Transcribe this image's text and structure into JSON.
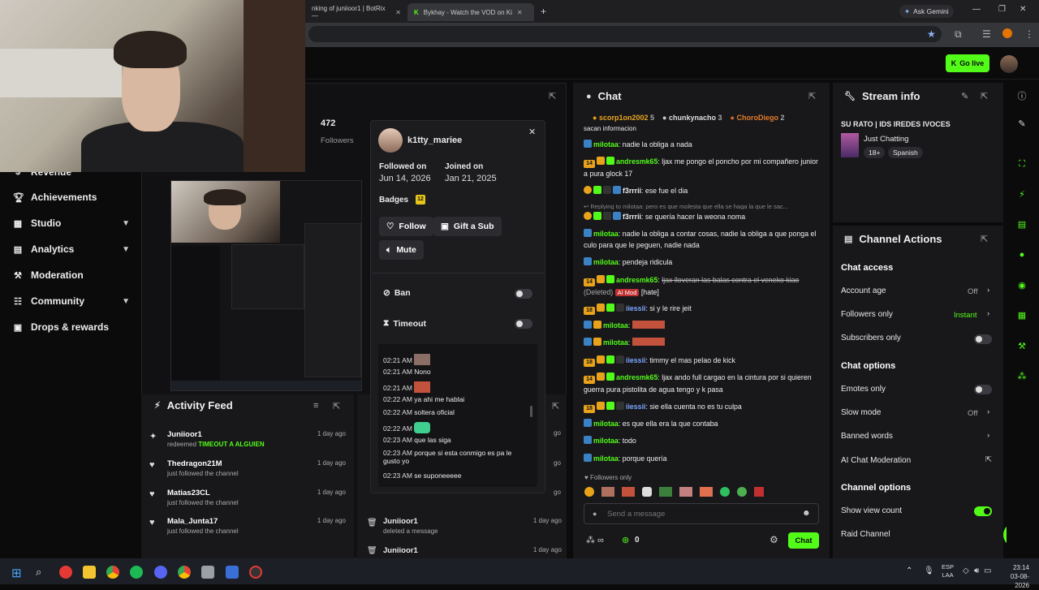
{
  "browser": {
    "tabs": [
      {
        "title": "nking of juniioor1 | BotRix—"
      },
      {
        "title": "Bykhay - Watch the VOD on Ki"
      }
    ],
    "ask_gemini": "Ask Gemini"
  },
  "header": {
    "go_live": "Go live"
  },
  "sidebar": {
    "items": [
      {
        "label": "Revenue",
        "icon": "revenue-icon"
      },
      {
        "label": "Achievements",
        "icon": "trophy-icon"
      },
      {
        "label": "Studio",
        "icon": "studio-icon",
        "chevron": true
      },
      {
        "label": "Analytics",
        "icon": "analytics-icon",
        "chevron": true
      },
      {
        "label": "Moderation",
        "icon": "hammer-icon"
      },
      {
        "label": "Community",
        "icon": "community-icon",
        "chevron": true
      },
      {
        "label": "Drops & rewards",
        "icon": "gift-icon"
      }
    ]
  },
  "stats": {
    "followers_count": "472",
    "followers_label": "Followers"
  },
  "activity_feed": {
    "title": "Activity Feed",
    "items": [
      {
        "name": "Juniioor1",
        "action": "redeemed",
        "reward": "TIMEOUT A ALGUIEN",
        "time": "1 day ago"
      },
      {
        "name": "Thedragon21M",
        "action": "just followed the channel",
        "time": "1 day ago"
      },
      {
        "name": "Matias23CL",
        "action": "just followed the channel",
        "time": "1 day ago"
      },
      {
        "name": "Mala_Junta17",
        "action": "just followed the channel",
        "time": "1 day ago"
      }
    ]
  },
  "mod_log": {
    "items": [
      {
        "name": "Juniioor1",
        "action": "deleted a message",
        "time": "1 day ago"
      },
      {
        "name": "Juniioor1",
        "time": "1 day ago"
      }
    ],
    "side_times": [
      "go",
      "go",
      "go"
    ]
  },
  "user_card": {
    "username": "k1tty_mariee",
    "followed_label": "Followed on",
    "followed_date": "Jun 14, 2026",
    "joined_label": "Joined on",
    "joined_date": "Jan 21, 2025",
    "badges_label": "Badges",
    "badges_count": "12",
    "follow": "Follow",
    "gift_sub": "Gift a Sub",
    "mute": "Mute",
    "ban": "Ban",
    "timeout": "Timeout",
    "messages": [
      {
        "time": "02:21 AM",
        "text": ""
      },
      {
        "time": "02:21 AM",
        "text": "Nono"
      },
      {
        "time": "02:21 AM",
        "text": ""
      },
      {
        "time": "02:22 AM",
        "text": "ya ahi me hablai"
      },
      {
        "time": "02:22 AM",
        "text": "soltera oficial"
      },
      {
        "time": "02:22 AM",
        "text": ""
      },
      {
        "time": "02:23 AM",
        "text": "que las siga"
      },
      {
        "time": "02:23 AM",
        "text": "porque si esta conmigo es pa le gusto yo"
      },
      {
        "time": "02:23 AM",
        "text": "se suponeeeee"
      }
    ]
  },
  "chat": {
    "title": "Chat",
    "top_gifters": [
      {
        "name": "scorp1on2002",
        "count": "5"
      },
      {
        "name": "chunkynacho",
        "count": "3"
      },
      {
        "name": "ChoroDiego",
        "count": "2"
      }
    ],
    "partial_top": "sacan informacion",
    "messages": [
      {
        "user": "milotaa",
        "color": "#53fc18",
        "text": "nadie la obliga a nada"
      },
      {
        "user": "andresmk65",
        "color": "#53fc18",
        "text": "ljax me pongo el poncho por mi compañero junior a pura glock 17",
        "badge_num": "14"
      },
      {
        "user": "f3rrrii",
        "color": "#ffffff",
        "text": "ese fue el dia"
      },
      {
        "reply": "Replying to milotaa: pero es que molesta que ella se haga la que le sac..."
      },
      {
        "user": "f3rrrii",
        "color": "#ffffff",
        "text": "se quería hacer la weona noma"
      },
      {
        "user": "milotaa",
        "color": "#53fc18",
        "text": "nadie la obliga a contar cosas, nadie la obliga a que ponga el culo para que le peguen, nadie nada"
      },
      {
        "user": "milotaa",
        "color": "#53fc18",
        "text": "pendeja ridicula"
      },
      {
        "user": "andresmk65",
        "color": "#53fc18",
        "text": "ljax lloveran las balas contra el veneko kiao",
        "deleted": "(Deleted)",
        "aimod": "AI Mod",
        "hate": "[hate]",
        "badge_num": "14"
      },
      {
        "user": "iiessii",
        "color": "#7aa7ff",
        "text": "si y le rire jeit",
        "badge_num": "18"
      },
      {
        "user": "milotaa",
        "color": "#53fc18",
        "text": ""
      },
      {
        "user": "milotaa",
        "color": "#53fc18",
        "text": ""
      },
      {
        "user": "iiessii",
        "color": "#7aa7ff",
        "text": "timmy el mas pelao de kick",
        "badge_num": "18"
      },
      {
        "user": "andresmk65",
        "color": "#53fc18",
        "text": "ljax ando full cargao en la cintura por si quieren guerra pura pistolita de agua tengo y k pasa",
        "badge_num": "14"
      },
      {
        "user": "iiessii",
        "color": "#7aa7ff",
        "text": "sie ella cuenta no es tu culpa",
        "badge_num": "18"
      },
      {
        "user": "milotaa",
        "color": "#53fc18",
        "text": "es que ella era la que contaba"
      },
      {
        "user": "milotaa",
        "color": "#53fc18",
        "text": "todo"
      },
      {
        "user": "milotaa",
        "color": "#53fc18",
        "text": "porque quería"
      }
    ],
    "followers_only": "Followers only",
    "placeholder": "Send a message",
    "count": "0",
    "send": "Chat"
  },
  "stream_info": {
    "title": "Stream info",
    "stream_title": "SU RATO | IDS IREDES IVOCES",
    "category": "Just Chatting",
    "tags": [
      "18+",
      "Spanish"
    ]
  },
  "channel_actions": {
    "title": "Channel Actions",
    "chat_access": "Chat access",
    "account_age": "Account age",
    "account_age_val": "Off",
    "followers_only": "Followers only",
    "followers_only_val": "Instant",
    "subscribers_only": "Subscribers only",
    "chat_options": "Chat options",
    "emotes_only": "Emotes only",
    "slow_mode": "Slow mode",
    "slow_mode_val": "Off",
    "banned_words": "Banned words",
    "ai_mod": "AI Chat Moderation",
    "channel_options": "Channel options",
    "show_view_count": "Show view count",
    "raid_channel": "Raid Channel"
  },
  "taskbar": {
    "lang": "ESP",
    "region": "LAA",
    "time": "23:14",
    "date": "03-08-2026"
  },
  "colors": {
    "accent": "#53fc18",
    "panel": "#18181b",
    "bg": "#0b0b0c"
  }
}
